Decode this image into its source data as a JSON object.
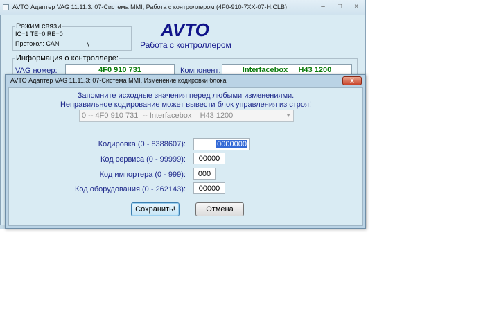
{
  "main_window": {
    "title": "AVTO Адаптер VAG 11.11.3: 07-Система MMI,  Работа с контроллером (4F0-910-7XX-07-H.CLB)",
    "controls": {
      "minimize": "–",
      "maximize": "□",
      "close": "×"
    },
    "connection": {
      "heading": "Режим связи",
      "stats": "IC=1  TE=0   RE=0",
      "protocol": "Протокол: CAN",
      "marker": "\\"
    },
    "logo": "AVTO",
    "subtitle": "Работа с контроллером",
    "controller_info": {
      "heading": "Информация о контроллере:",
      "vag_label": "VAG номер:",
      "vag_value": "4F0 910 731",
      "component_label": "Компонент:",
      "component_value": "Interfacebox     H43 1200"
    }
  },
  "dialog": {
    "title": "AVTO Адаптер VAG 11.11.3: 07-Система MMI,  Изменение кодировки блока",
    "close": "x",
    "warning_line1": "Запомните исходные значения перед любыми изменениями.",
    "warning_line2": "Неправильное кодирование может вывести блок управления из строя!",
    "combo_value": "0 -- 4F0 910 731  -- Interfacebox    H43 1200",
    "fields": {
      "coding_label": "Кодировка (0 - 8388607):",
      "coding_value": "0000000",
      "service_label": "Код сервиса (0 - 99999):",
      "service_value": "00000",
      "importer_label": "Код импортера (0 - 999):",
      "importer_value": "000",
      "equipment_label": "Код оборудования (0 - 262143):",
      "equipment_value": "00000"
    },
    "save_label": "Сохранить!",
    "cancel_label": "Отмена"
  }
}
